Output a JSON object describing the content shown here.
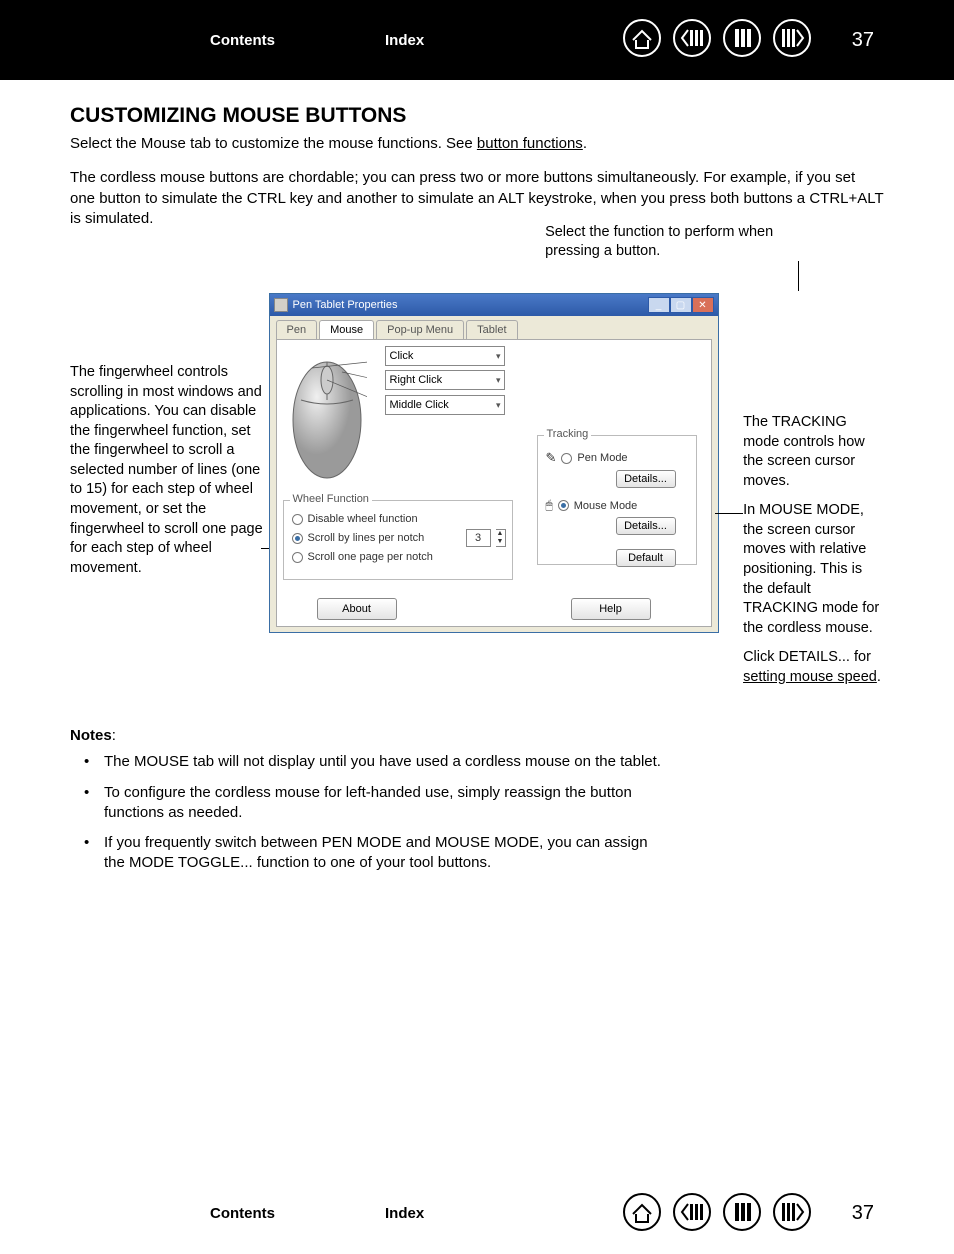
{
  "page_number": "37",
  "nav": {
    "contents": "Contents",
    "index": "Index"
  },
  "title": "CUSTOMIZING MOUSE BUTTONS",
  "intro1_a": "Select the Mouse tab to customize the mouse functions.  See ",
  "intro1_link": "button functions",
  "intro1_b": ".",
  "intro2": "The cordless mouse buttons are chordable; you can press two or more buttons simultaneously. For example, if you set one button to simulate the CTRL key and another to simulate an ALT keystroke, when you press both buttons a CTRL+ALT is simulated.",
  "topcallout": "Select the function to perform when pressing a button.",
  "left_callout": "The fingerwheel controls scrolling in most windows and applications. You can disable the fingerwheel function, set the fingerwheel to scroll a selected number of lines (one to 15) for each step of wheel movement, or set the fingerwheel to scroll one page for each step of wheel movement.",
  "right": {
    "p1": "The TRACKING mode controls how the screen cursor moves.",
    "p2": "In MOUSE MODE, the screen cursor moves with relative positioning. This is the default TRACKING mode for the cordless mouse.",
    "p3a": "Click DETAILS... for ",
    "p3link": "setting mouse speed",
    "p3b": "."
  },
  "dialog": {
    "title": "Pen Tablet Properties",
    "tabs": [
      "Pen",
      "Mouse",
      "Pop-up Menu",
      "Tablet"
    ],
    "combo1": "Click",
    "combo2": "Right Click",
    "combo3": "Middle Click",
    "tracking_header": "Tracking",
    "pen_mode": "Pen Mode",
    "mouse_mode": "Mouse Mode",
    "details": "Details...",
    "default": "Default",
    "wheel_header": "Wheel Function",
    "wheel_opt1": "Disable wheel function",
    "wheel_opt2": "Scroll by lines per notch",
    "wheel_opt3": "Scroll one page per notch",
    "spin_val": "3",
    "about": "About",
    "help": "Help"
  },
  "notes_header": "Notes",
  "notes": [
    "The MOUSE tab will not display until you have used a cordless mouse on the tablet.",
    "To configure the cordless mouse for left-handed use, simply reassign the button functions as needed.",
    "If you frequently switch between PEN MODE and MOUSE MODE, you can assign the MODE TOGGLE... function to one of your tool buttons."
  ]
}
